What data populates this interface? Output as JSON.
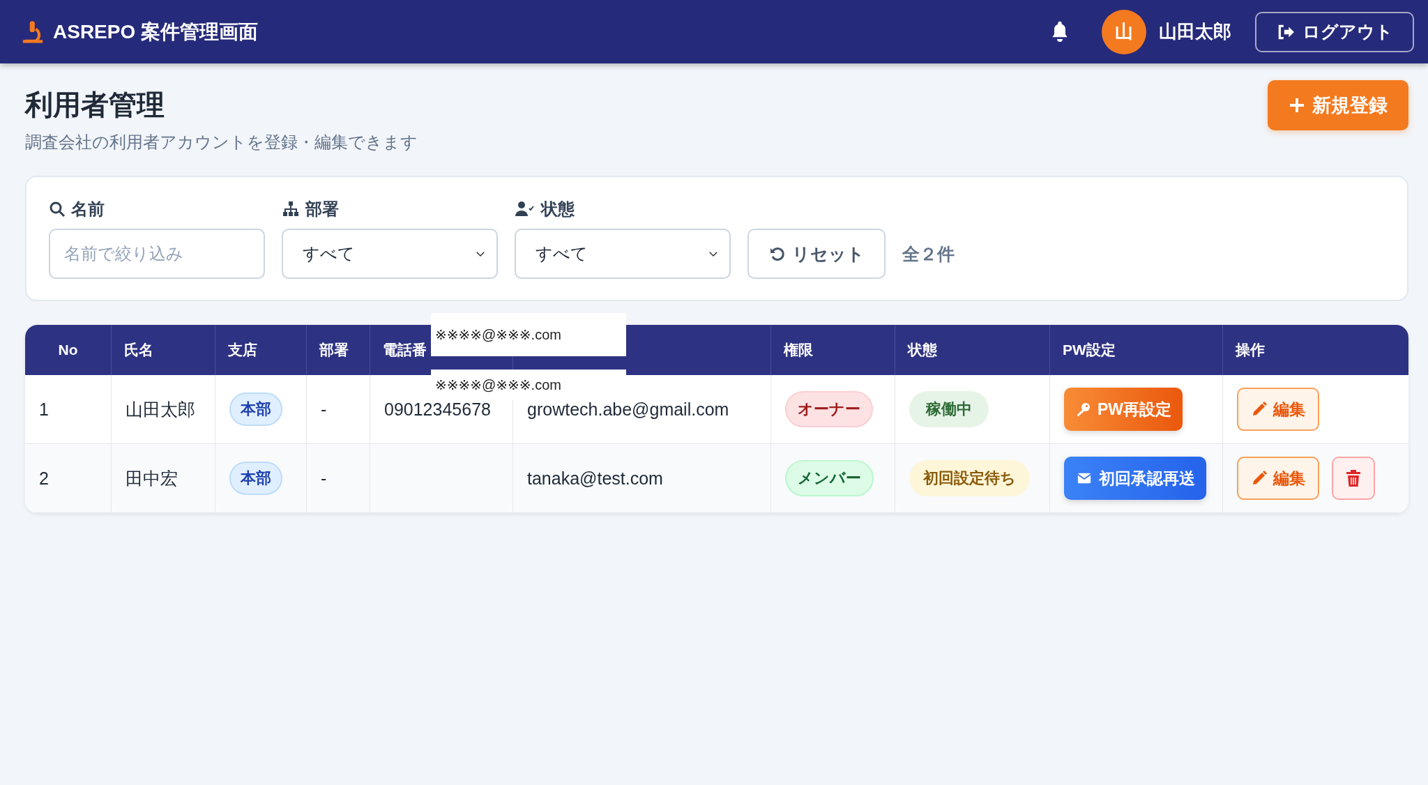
{
  "header": {
    "app_title": "ASREPO 案件管理画面",
    "avatar_initial": "山",
    "user_name": "山田太郎",
    "logout": "ログアウト"
  },
  "page": {
    "title": "利用者管理",
    "subtitle": "調査会社の利用者アカウントを登録・編集できます",
    "new_button": "新規登録"
  },
  "filters": {
    "name_label": "名前",
    "name_placeholder": "名前で絞り込み",
    "dept_label": "部署",
    "dept_value": "すべて",
    "status_label": "状態",
    "status_value": "すべて",
    "reset": "リセット",
    "count": "全２件"
  },
  "table": {
    "columns": [
      "No",
      "氏名",
      "支店",
      "部署",
      "電話番",
      "",
      "権限",
      "状態",
      "PW設定",
      "操作"
    ],
    "rows": [
      {
        "no": "1",
        "name": "山田太郎",
        "branch": "本部",
        "dept": "-",
        "phone": "09012345678",
        "email": "growtech.abe@gmail.com",
        "role": {
          "kind": "owner",
          "label": "オーナー"
        },
        "status": {
          "kind": "active",
          "label": "稼働中"
        },
        "pw": {
          "kind": "reset",
          "label": "PW再設定"
        },
        "edit": "編集",
        "deletable": false
      },
      {
        "no": "2",
        "name": "田中宏",
        "branch": "本部",
        "dept": "-",
        "phone": "",
        "email": "tanaka@test.com",
        "role": {
          "kind": "member",
          "label": "メンバー"
        },
        "status": {
          "kind": "pending",
          "label": "初回設定待ち"
        },
        "pw": {
          "kind": "resend",
          "label": "初回承認再送"
        },
        "edit": "編集",
        "deletable": true
      }
    ]
  },
  "redaction_labels": [
    "※※※※@※※※.com",
    "※※※※@※※※.com"
  ]
}
